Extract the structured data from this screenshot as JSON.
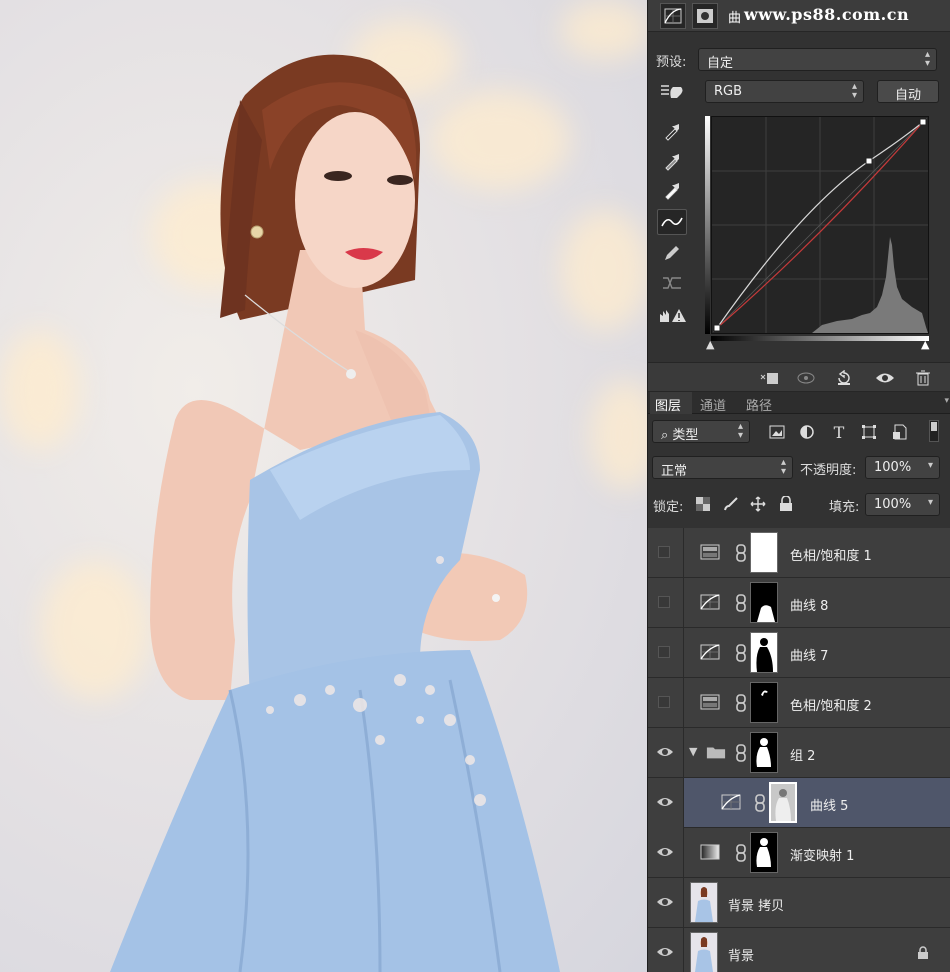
{
  "watermark": "www.ps88.com.cn",
  "properties": {
    "title_char": "曲",
    "preset_label": "预设:",
    "preset_value": "自定",
    "channel_value": "RGB",
    "auto_button": "自动"
  },
  "icons": {
    "curves": "curves-adjustment-icon",
    "mask": "mask-icon",
    "hand": "on-image-adjust-icon",
    "eyedropper_black": "black-point-eyedropper-icon",
    "eyedropper_gray": "gray-point-eyedropper-icon",
    "eyedropper_white": "white-point-eyedropper-icon",
    "curve_tool": "curve-edit-tool-icon",
    "pencil": "pencil-draw-icon",
    "smooth": "smooth-curve-icon",
    "clip_warning": "clipping-warning-icon"
  },
  "layers_panel": {
    "tabs": [
      "图层",
      "通道",
      "路径"
    ],
    "filter_label": "类型",
    "blend_mode": "正常",
    "opacity_label": "不透明度:",
    "opacity_value": "100%",
    "lock_label": "锁定:",
    "fill_label": "填充:",
    "fill_value": "100%",
    "layers": [
      {
        "name": "色相/饱和度 1",
        "visible": false,
        "type": "hue-saturation",
        "mask": "white"
      },
      {
        "name": "曲线 8",
        "visible": false,
        "type": "curves",
        "mask": "black-dress"
      },
      {
        "name": "曲线 7",
        "visible": false,
        "type": "curves",
        "mask": "white-silhouette-on-black"
      },
      {
        "name": "色相/饱和度 2",
        "visible": false,
        "type": "hue-saturation",
        "mask": "black-head"
      },
      {
        "name": "组 2",
        "visible": true,
        "type": "group",
        "mask": "silhouette"
      },
      {
        "name": "曲线 5",
        "visible": true,
        "type": "curves",
        "mask": "portrait",
        "selected": true
      },
      {
        "name": "渐变映射 1",
        "visible": true,
        "type": "gradient-map",
        "mask": "silhouette"
      },
      {
        "name": "背景 拷贝",
        "visible": true,
        "type": "pixel",
        "mask": "photo"
      },
      {
        "name": "背景",
        "visible": true,
        "type": "pixel",
        "mask": "photo",
        "locked": true
      }
    ]
  },
  "colors": {
    "panel_bg": "#323232",
    "selected_row": "#4f566a",
    "curve_red": "#c43a3a",
    "curve_white": "#d8d8d8",
    "dress_blue": "#a9c6e8"
  }
}
